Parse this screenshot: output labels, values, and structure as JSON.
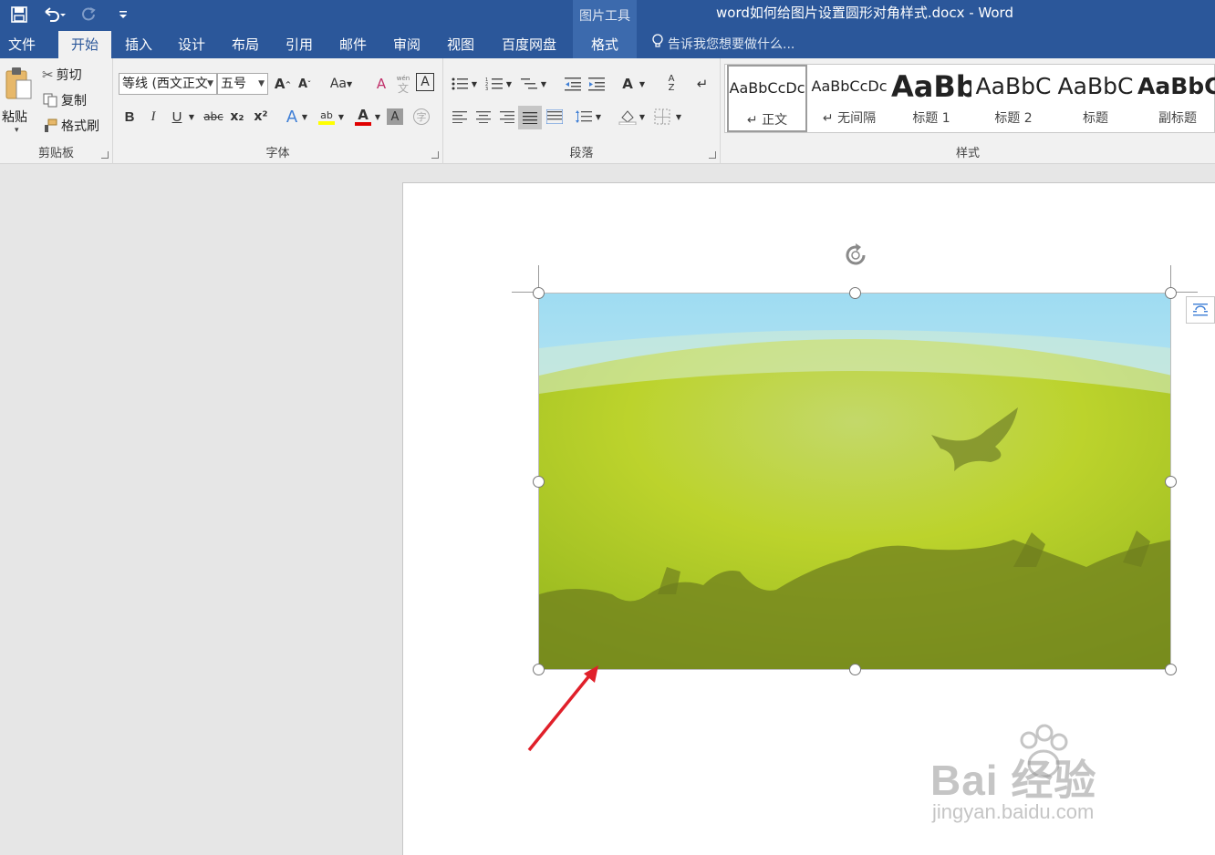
{
  "window": {
    "title": "word如何给图片设置圆形对角样式.docx - Word",
    "context_tools": "图片工具"
  },
  "quick_access": {
    "save_icon": "save-icon",
    "undo_icon": "undo-icon",
    "redo_icon": "redo-icon",
    "customize_icon": "customize-icon"
  },
  "tabs": [
    {
      "label": "文件"
    },
    {
      "label": "开始"
    },
    {
      "label": "插入"
    },
    {
      "label": "设计"
    },
    {
      "label": "布局"
    },
    {
      "label": "引用"
    },
    {
      "label": "邮件"
    },
    {
      "label": "审阅"
    },
    {
      "label": "视图"
    },
    {
      "label": "百度网盘"
    },
    {
      "label": "格式"
    }
  ],
  "tell_me": "告诉我您想要做什么...",
  "clipboard": {
    "paste": "粘贴",
    "cut": "剪切",
    "copy": "复制",
    "format_painter": "格式刷",
    "group_label": "剪贴板"
  },
  "font": {
    "name": "等线 (西文正文",
    "size": "五号",
    "bold": "B",
    "italic": "I",
    "underline": "U",
    "strike": "abc",
    "subscript": "x₂",
    "superscript": "x²",
    "change_case": "Aa",
    "font_color_letter": "A",
    "group_label": "字体",
    "phonetic": "wén",
    "phonetic_base": "文",
    "enclose": "字"
  },
  "paragraph": {
    "group_label": "段落"
  },
  "styles": {
    "group_label": "样式",
    "items": [
      {
        "preview": "AaBbCcDc",
        "name": "↵ 正文"
      },
      {
        "preview": "AaBbCcDc",
        "name": "↵ 无间隔"
      },
      {
        "preview": "AaBb",
        "name": "标题 1"
      },
      {
        "preview": "AaBbC",
        "name": "标题 2"
      },
      {
        "preview": "AaBbC",
        "name": "标题"
      },
      {
        "preview": "AaBbC",
        "name": "副标题"
      }
    ]
  },
  "watermark": {
    "main": "Bai 经验",
    "sub": "jingyan.baidu.com"
  },
  "colors": {
    "titlebar": "#2b579a",
    "context": "#3c6aad",
    "highlight": "#ffff00",
    "font_red": "#e00000",
    "arrow": "#e0202a"
  }
}
